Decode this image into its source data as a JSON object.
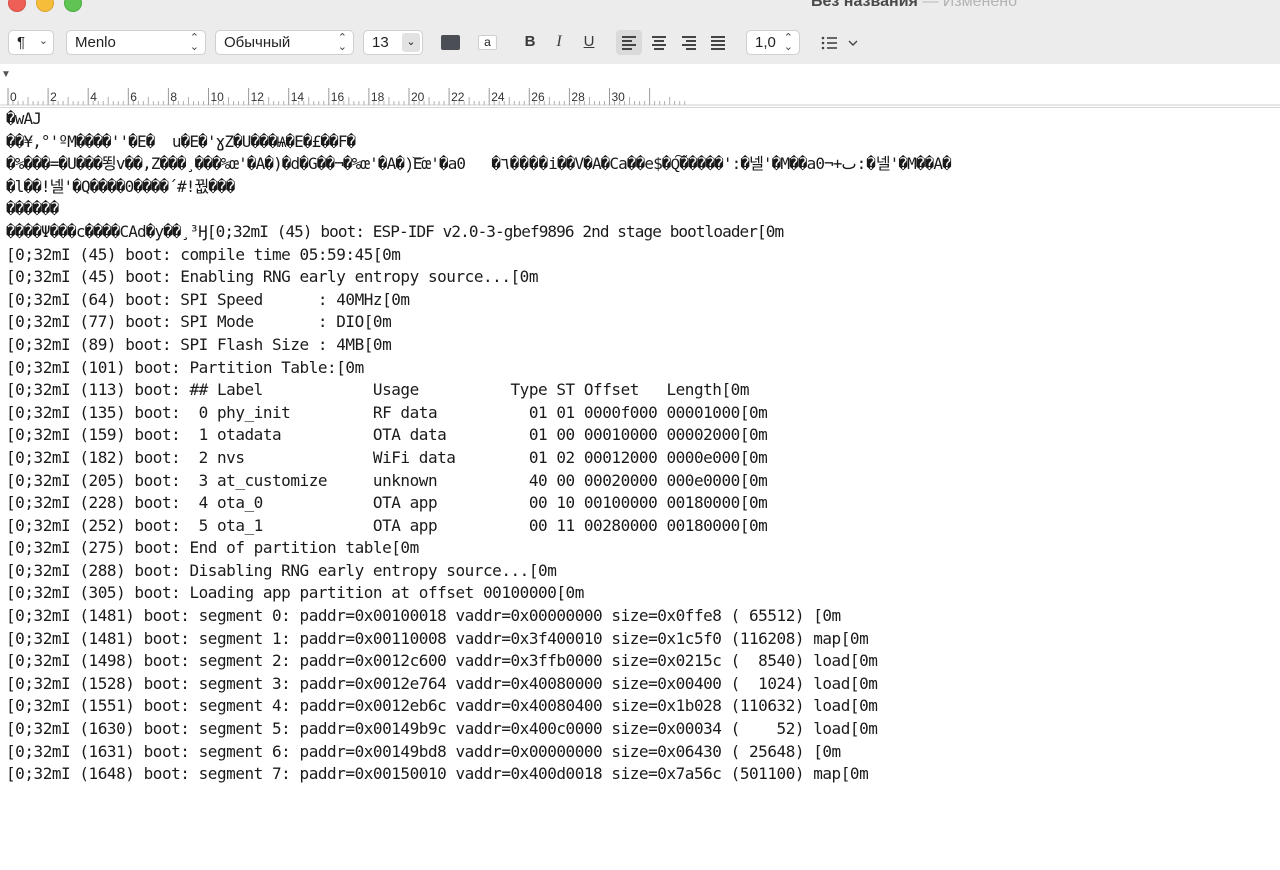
{
  "window": {
    "title": "Без названия",
    "separator": "—",
    "subtitle": "Изменено"
  },
  "toolbar": {
    "paragraph_symbol": "¶",
    "font_family": "Menlo",
    "font_style": "Обычный",
    "font_size": "13",
    "text_color": "#4b4e54",
    "highlight_label": "a",
    "bold_label": "B",
    "italic_label": "I",
    "underline_label": "U",
    "line_spacing": "1,0",
    "icons": [
      "paragraph-icon",
      "chevron-down-icon",
      "align-left-icon",
      "align-center-icon",
      "align-right-icon",
      "align-justify-icon",
      "list-icon"
    ]
  },
  "ruler": {
    "marker": "▼",
    "labels": [
      "0",
      "2",
      "4",
      "6",
      "8",
      "10",
      "12",
      "14",
      "16",
      "18",
      "20",
      "22",
      "24",
      "26",
      "28",
      "30"
    ]
  },
  "document": {
    "lines": [
      "�wAJ",
      "��¥,°'ºM����''�E�  u�E�'ɣZ�U���Ѩ�E�£��F�",
      "�%���=�U���뙹v��,Z���¸���%œ'�A�)�d�G��¬�%œ'�A�)͝Eœ'�a0   �٦����i��V�A�Ca��e$�Q͠�����':�넬'�M��a0¬+ٮ:�넬'�M��A�",
      "�l��!넬'�Q����0����´#!꿦���",
      "������",
      "����Ψ���c����CAd�y��¸³Ӈ[0;32mI (45) boot: ESP-IDF v2.0-3-gbef9896 2nd stage bootloader[0m",
      "[0;32mI (45) boot: compile time 05:59:45[0m",
      "[0;32mI (45) boot: Enabling RNG early entropy source...[0m",
      "[0;32mI (64) boot: SPI Speed      : 40MHz[0m",
      "[0;32mI (77) boot: SPI Mode       : DIO[0m",
      "[0;32mI (89) boot: SPI Flash Size : 4MB[0m",
      "[0;32mI (101) boot: Partition Table:[0m",
      "[0;32mI (113) boot: ## Label            Usage          Type ST Offset   Length[0m",
      "[0;32mI (135) boot:  0 phy_init         RF data          01 01 0000f000 00001000[0m",
      "[0;32mI (159) boot:  1 otadata          OTA data         01 00 00010000 00002000[0m",
      "[0;32mI (182) boot:  2 nvs              WiFi data        01 02 00012000 0000e000[0m",
      "[0;32mI (205) boot:  3 at_customize     unknown          40 00 00020000 000e0000[0m",
      "[0;32mI (228) boot:  4 ota_0            OTA app          00 10 00100000 00180000[0m",
      "[0;32mI (252) boot:  5 ota_1            OTA app          00 11 00280000 00180000[0m",
      "[0;32mI (275) boot: End of partition table[0m",
      "[0;32mI (288) boot: Disabling RNG early entropy source...[0m",
      "[0;32mI (305) boot: Loading app partition at offset 00100000[0m",
      "[0;32mI (1481) boot: segment 0: paddr=0x00100018 vaddr=0x00000000 size=0x0ffe8 ( 65512) [0m",
      "[0;32mI (1481) boot: segment 1: paddr=0x00110008 vaddr=0x3f400010 size=0x1c5f0 (116208) map[0m",
      "[0;32mI (1498) boot: segment 2: paddr=0x0012c600 vaddr=0x3ffb0000 size=0x0215c (  8540) load[0m",
      "[0;32mI (1528) boot: segment 3: paddr=0x0012e764 vaddr=0x40080000 size=0x00400 (  1024) load[0m",
      "[0;32mI (1551) boot: segment 4: paddr=0x0012eb6c vaddr=0x40080400 size=0x1b028 (110632) load[0m",
      "[0;32mI (1630) boot: segment 5: paddr=0x00149b9c vaddr=0x400c0000 size=0x00034 (    52) load[0m",
      "[0;32mI (1631) boot: segment 6: paddr=0x00149bd8 vaddr=0x00000000 size=0x06430 ( 25648) [0m",
      "[0;32mI (1648) boot: segment 7: paddr=0x00150010 vaddr=0x400d0018 size=0x7a56c (501100) map[0m"
    ]
  }
}
